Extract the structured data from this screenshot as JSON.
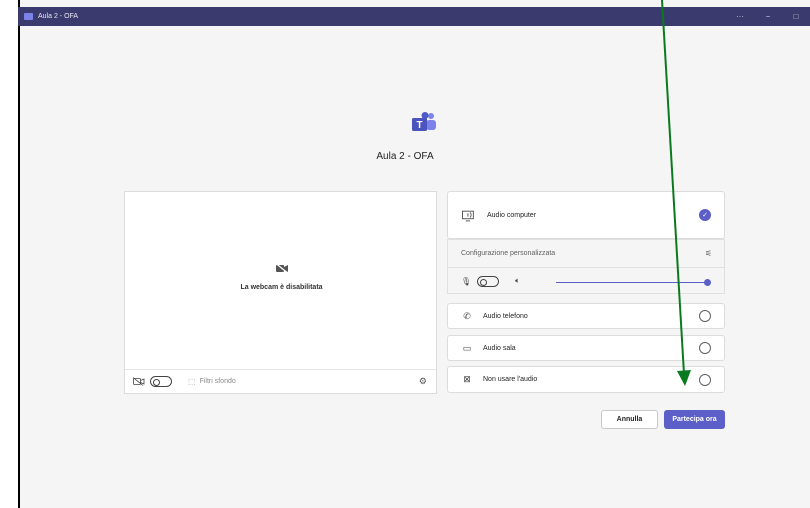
{
  "window": {
    "title": "Aula 2 - OFA",
    "controls": [
      "···",
      "−",
      "□"
    ]
  },
  "meeting": {
    "title": "Aula 2 - OFA"
  },
  "video": {
    "camera_off_text": "La webcam è disabilitata",
    "background_filters_label": "Filtri sfondo"
  },
  "audio": {
    "computer_label": "Audio computer",
    "custom_config_label": "Configurazione personalizzata",
    "phone_label": "Audio telefono",
    "room_label": "Audio sala",
    "no_audio_label": "Non usare l'audio",
    "volume_level": 1.0
  },
  "actions": {
    "cancel_label": "Annulla",
    "join_label": "Partecipa ora"
  },
  "colors": {
    "accent": "#5b5fc7",
    "titlebar": "#3b3a6e",
    "annotation_arrow": "#0a7a1e"
  }
}
